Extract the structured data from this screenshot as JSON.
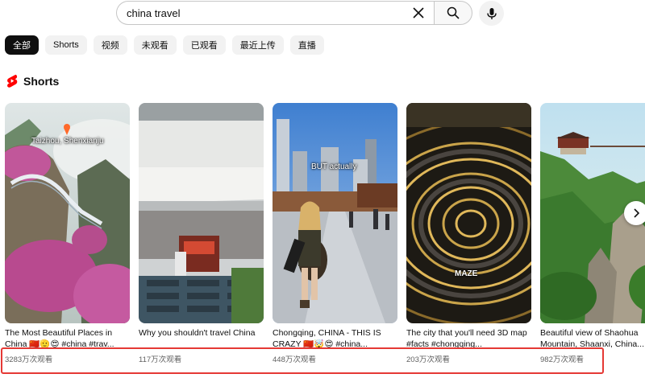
{
  "search": {
    "query": "china travel"
  },
  "chips": [
    "全部",
    "Shorts",
    "视频",
    "未观看",
    "已观看",
    "最近上传",
    "直播"
  ],
  "section": {
    "title": "Shorts"
  },
  "cards": [
    {
      "title": "The Most Beautiful Places in China 🇨🇳🫡😍 #china #trav...",
      "views": "3283万次观看",
      "overlay": "Taizhou, Shenxianju"
    },
    {
      "title": "Why you shouldn't travel China",
      "views": "117万次观看"
    },
    {
      "title": "Chongqing, CHINA - THIS IS CRAZY 🇨🇳🤯😍 #china...",
      "views": "448万次观看",
      "overlay": "BUT actually"
    },
    {
      "title": "The city that you'll need 3D map #facts #chongqing...",
      "views": "203万次观看",
      "overlay": "MAZE"
    },
    {
      "title": "Beautiful view of Shaohua Mountain, Shaanxi, China...",
      "views": "982万次观看"
    }
  ],
  "colors": {
    "shorts_red": "#ff0000",
    "highlight": "#e53935"
  }
}
